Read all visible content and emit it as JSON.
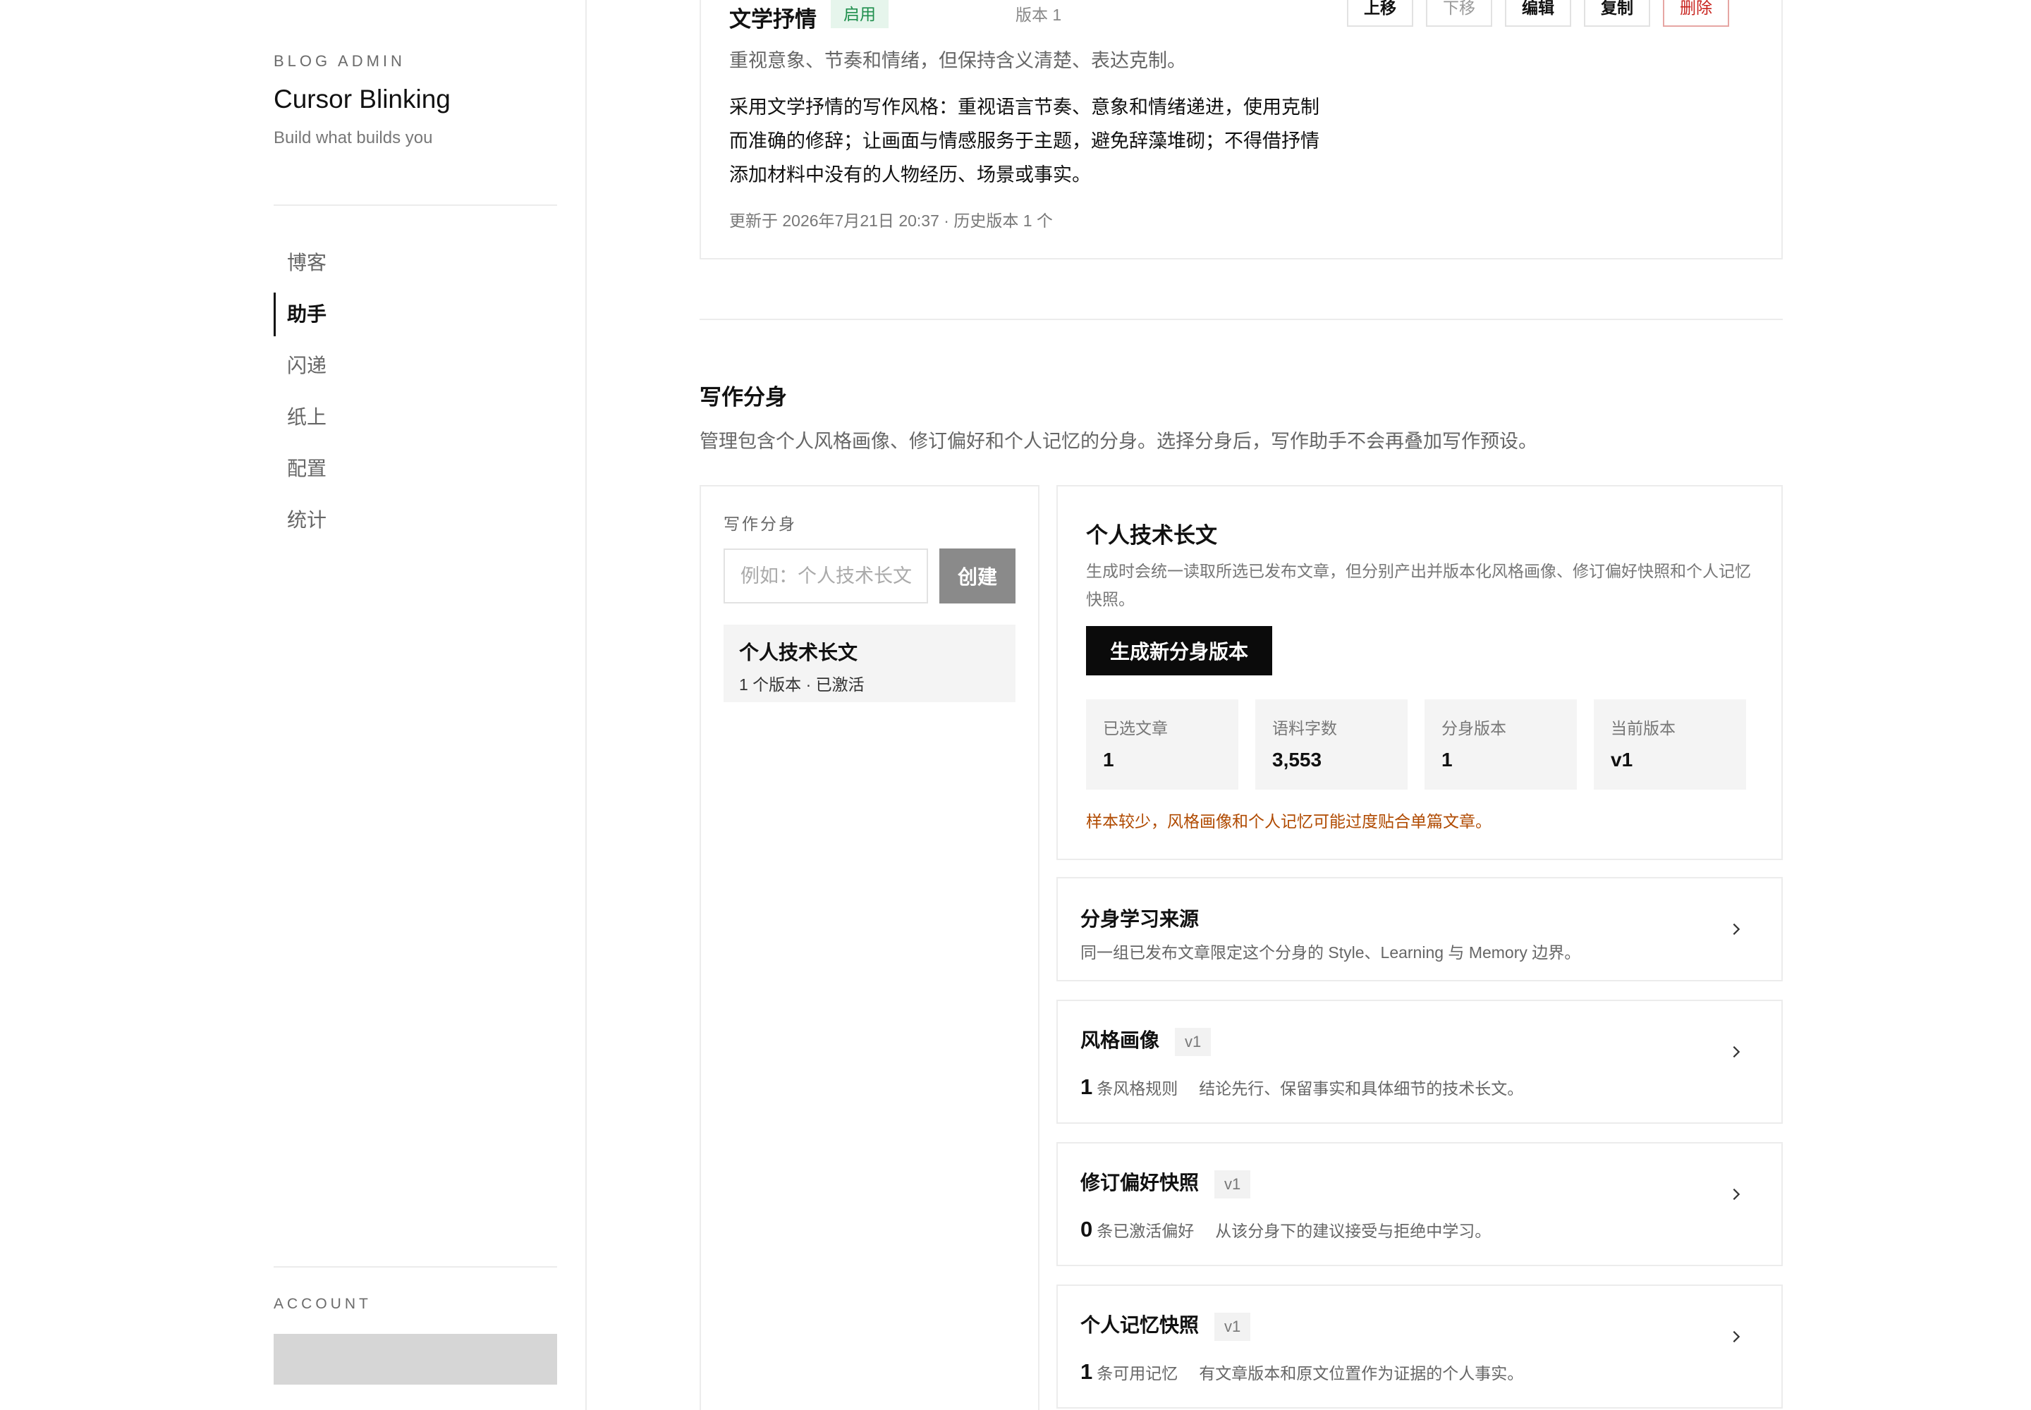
{
  "sidebar": {
    "kicker": "BLOG ADMIN",
    "title": "Cursor Blinking",
    "tagline": "Build what builds you",
    "nav": [
      {
        "label": "博客",
        "active": false
      },
      {
        "label": "助手",
        "active": true
      },
      {
        "label": "闪递",
        "active": false
      },
      {
        "label": "纸上",
        "active": false
      },
      {
        "label": "配置",
        "active": false
      },
      {
        "label": "统计",
        "active": false
      }
    ],
    "account_label": "ACCOUNT"
  },
  "preset": {
    "title": "文学抒情",
    "badge": "启用",
    "version": "版本 1",
    "actions": {
      "move_up": "上移",
      "move_down": "下移",
      "edit": "编辑",
      "copy": "复制",
      "delete": "删除"
    },
    "description": "重视意象、节奏和情绪，但保持含义清楚、表达克制。",
    "body": "采用文学抒情的写作风格：重视语言节奏、意象和情绪递进，使用克制而准确的修辞；让画面与情感服务于主题，避免辞藻堆砌；不得借抒情添加材料中没有的人物经历、场景或事实。",
    "meta": "更新于 2026年7月21日 20:37 · 历史版本 1 个"
  },
  "section": {
    "title": "写作分身",
    "description": "管理包含个人风格画像、修订偏好和个人记忆的分身。选择分身后，写作助手不会再叠加写作预设。"
  },
  "avatar_panel": {
    "label": "写作分身",
    "input_placeholder": "例如：个人技术长文",
    "create_label": "创建",
    "items": [
      {
        "name": "个人技术长文",
        "meta": "1 个版本 · 已激活"
      }
    ]
  },
  "detail": {
    "title": "个人技术长文",
    "description": "生成时会统一读取所选已发布文章，但分别产出并版本化风格画像、修订偏好快照和个人记忆快照。",
    "generate_label": "生成新分身版本",
    "stats": [
      {
        "label": "已选文章",
        "value": "1"
      },
      {
        "label": "语料字数",
        "value": "3,553"
      },
      {
        "label": "分身版本",
        "value": "1"
      },
      {
        "label": "当前版本",
        "value": "v1"
      }
    ],
    "warning": "样本较少，风格画像和个人记忆可能过度贴合单篇文章。"
  },
  "rows": {
    "sources": {
      "title": "分身学习来源",
      "description": "同一组已发布文章限定这个分身的 Style、Learning 与 Memory 边界。"
    },
    "style": {
      "title": "风格画像",
      "version": "v1",
      "count": "1",
      "count_label": "条风格规则",
      "description": "结论先行、保留事实和具体细节的技术长文。"
    },
    "revision": {
      "title": "修订偏好快照",
      "version": "v1",
      "count": "0",
      "count_label": "条已激活偏好",
      "description": "从该分身下的建议接受与拒绝中学习。"
    },
    "memory": {
      "title": "个人记忆快照",
      "version": "v1",
      "count": "1",
      "count_label": "条可用记忆",
      "description": "有文章版本和原文位置作为证据的个人事实。"
    }
  },
  "colors": {
    "accent": "#0b0b0b",
    "enabled_badge_text": "#1f8f4d",
    "enabled_badge_bg": "#e6f5ec",
    "danger": "#c8231e",
    "warning": "#b04a00"
  }
}
